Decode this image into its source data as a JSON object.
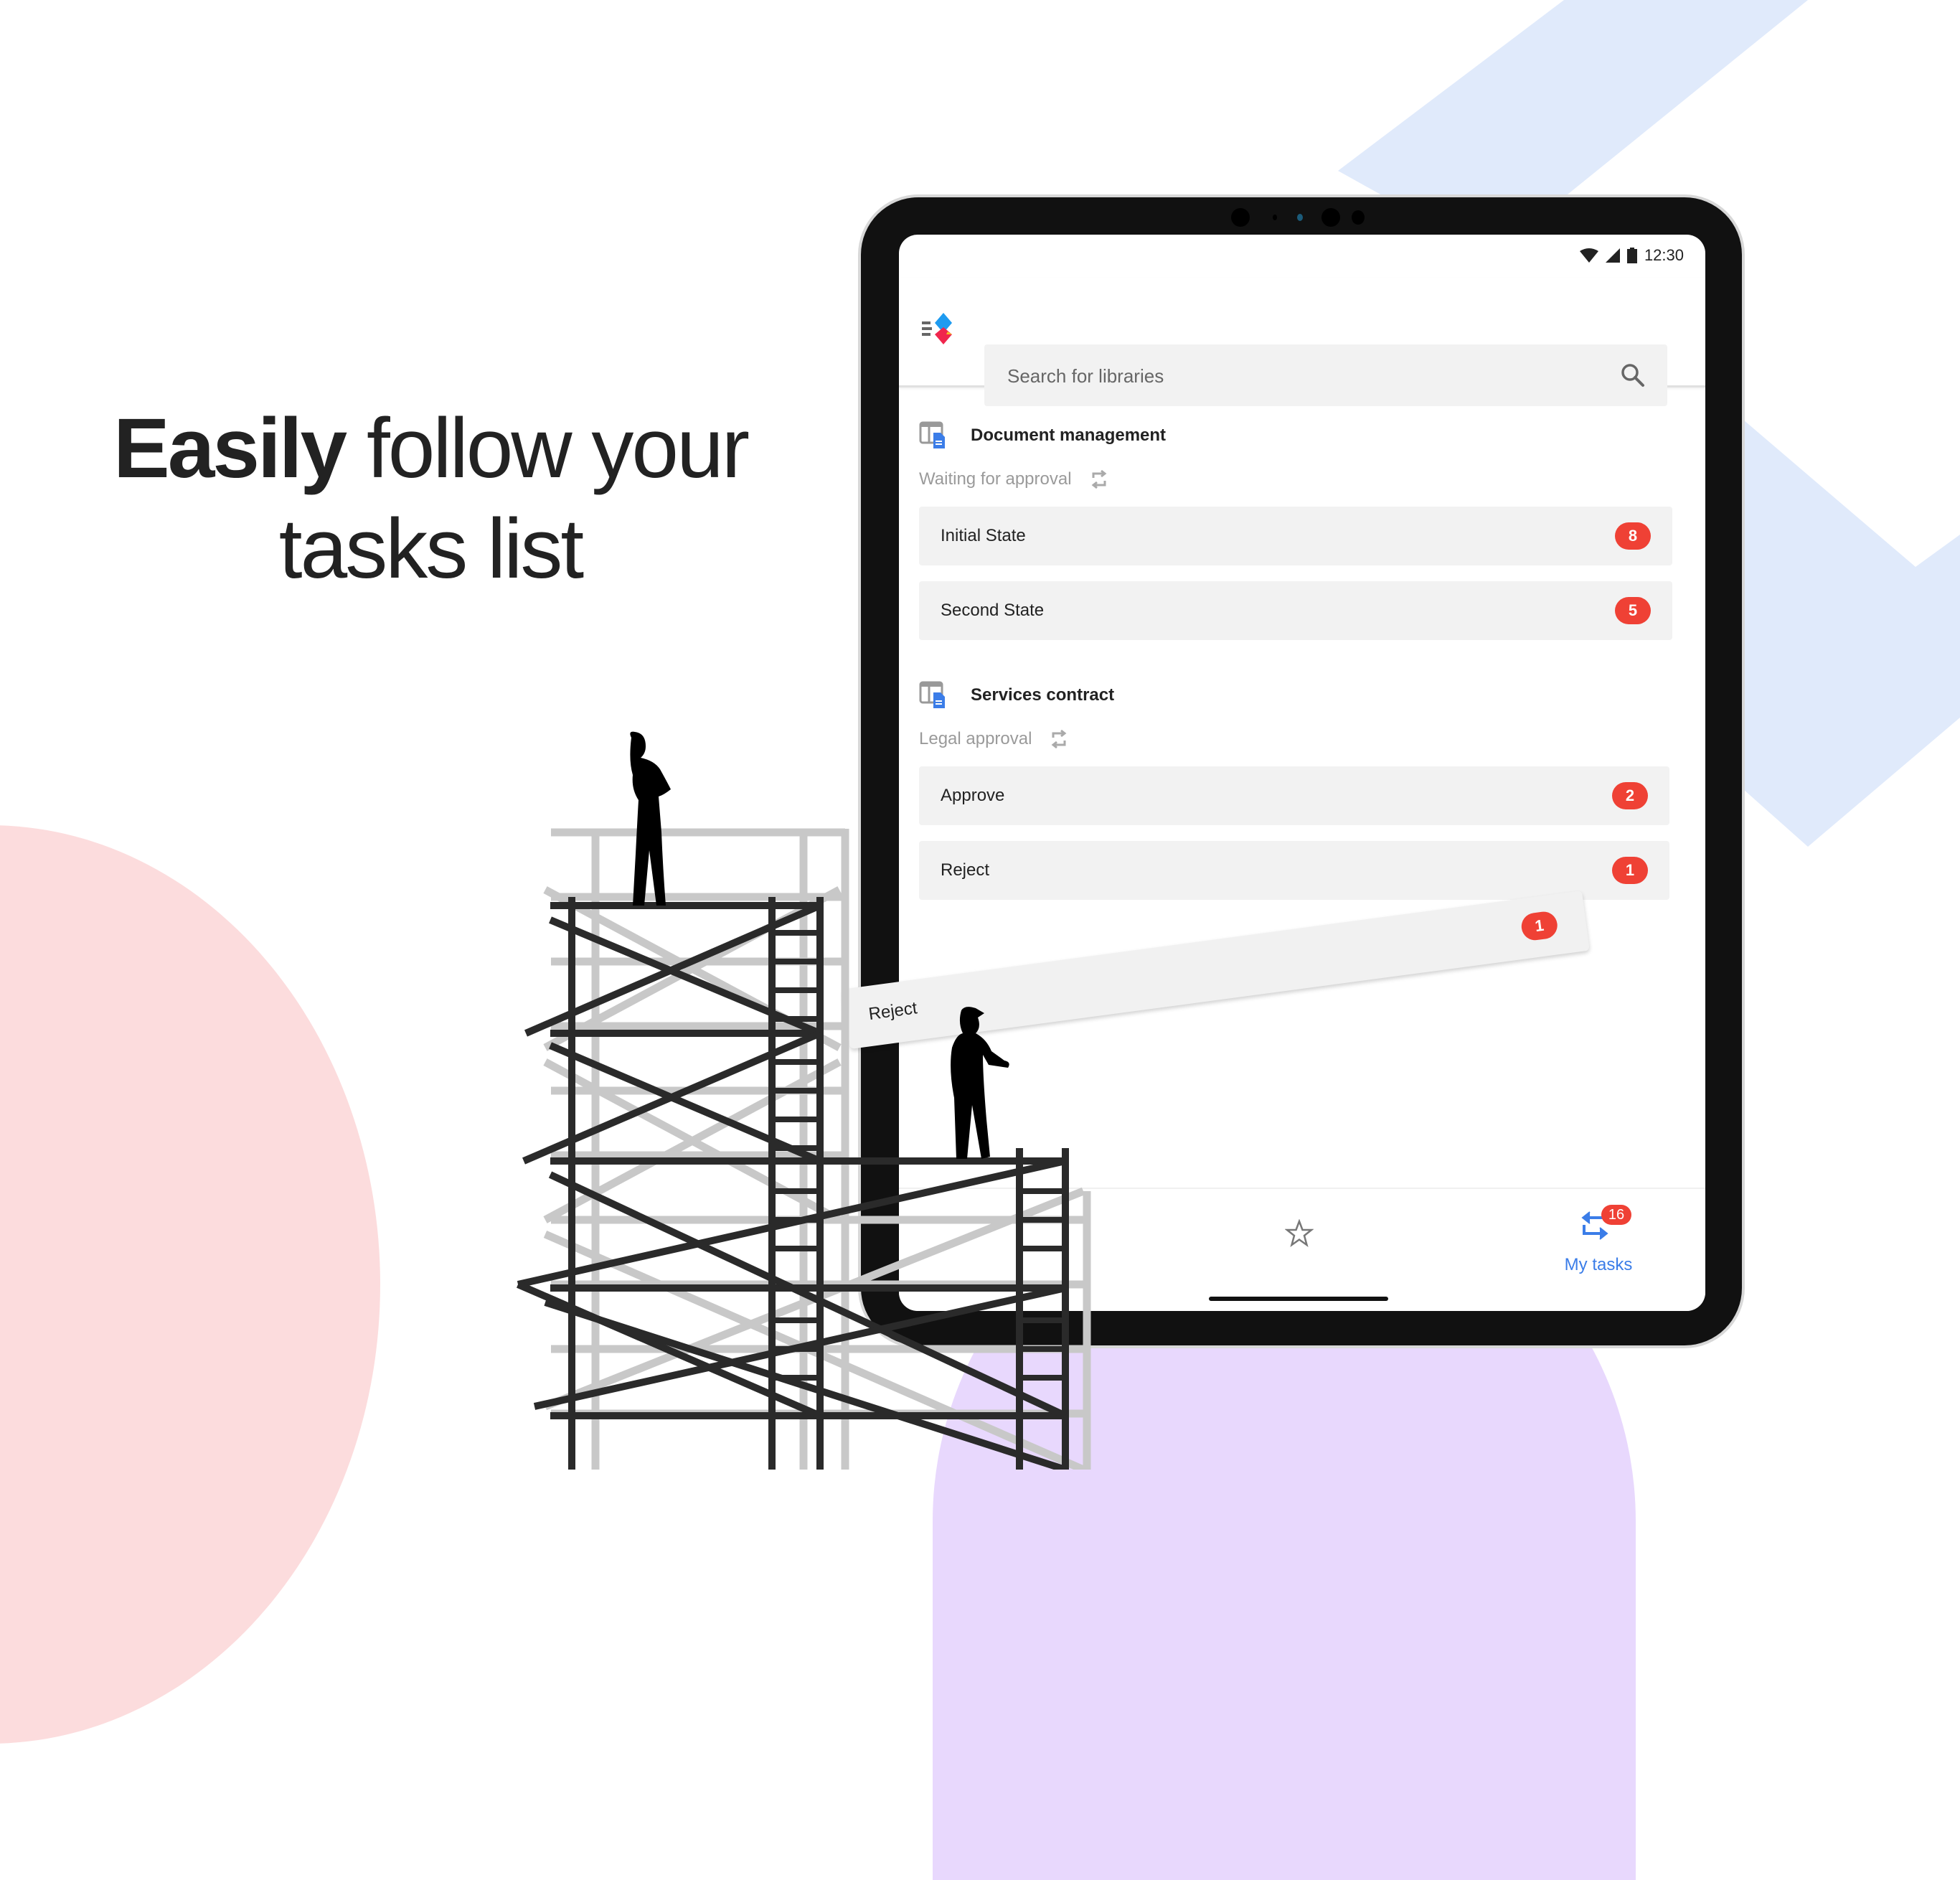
{
  "headline": {
    "bold": "Easily",
    "line1_rest": "follow your",
    "line2": "tasks list"
  },
  "status_bar": {
    "time": "12:30",
    "icons": [
      "wifi-icon",
      "signal-icon",
      "battery-icon"
    ]
  },
  "app": {
    "logo": "app-logo",
    "search": {
      "placeholder": "Search for libraries",
      "value": "",
      "icon": "search-icon"
    },
    "libraries": [
      {
        "title": "Document management",
        "workflow": "Waiting for approval",
        "icon": "library-document-icon",
        "states": [
          {
            "label": "Initial State",
            "count": "8"
          },
          {
            "label": "Second State",
            "count": "5"
          }
        ]
      },
      {
        "title": "Services contract",
        "workflow": "Legal approval",
        "icon": "library-document-icon",
        "states": [
          {
            "label": "Approve",
            "count": "2"
          },
          {
            "label": "Reject",
            "count": "1"
          }
        ]
      }
    ],
    "floating_row": {
      "label": "Reject",
      "count": "1"
    },
    "bottom_nav": {
      "favorites_icon": "star-icon",
      "my_tasks": {
        "label": "My tasks",
        "badge": "16",
        "icon": "tasks-swap-icon"
      }
    }
  },
  "colors": {
    "badge_red": "#ef4135",
    "accent_blue": "#3b7de8",
    "row_bg": "#f2f2f2",
    "bg_pink": "#fcdcdd",
    "bg_purple": "#e8d8fd",
    "bg_blue": "#e0eafb"
  }
}
